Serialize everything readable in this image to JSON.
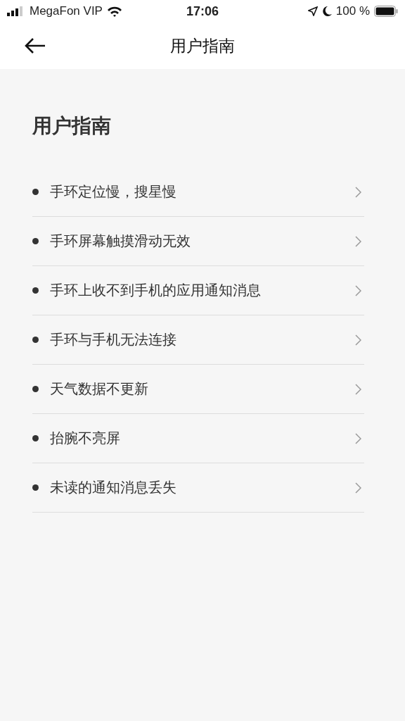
{
  "status_bar": {
    "carrier": "MegaFon VIP",
    "time": "17:06",
    "battery": "100 %"
  },
  "nav": {
    "title": "用户指南"
  },
  "heading": "用户指南",
  "items": [
    {
      "label": "手环定位慢，搜星慢"
    },
    {
      "label": "手环屏幕触摸滑动无效"
    },
    {
      "label": "手环上收不到手机的应用通知消息"
    },
    {
      "label": "手环与手机无法连接"
    },
    {
      "label": "天气数据不更新"
    },
    {
      "label": "抬腕不亮屏"
    },
    {
      "label": "未读的通知消息丢失"
    }
  ]
}
